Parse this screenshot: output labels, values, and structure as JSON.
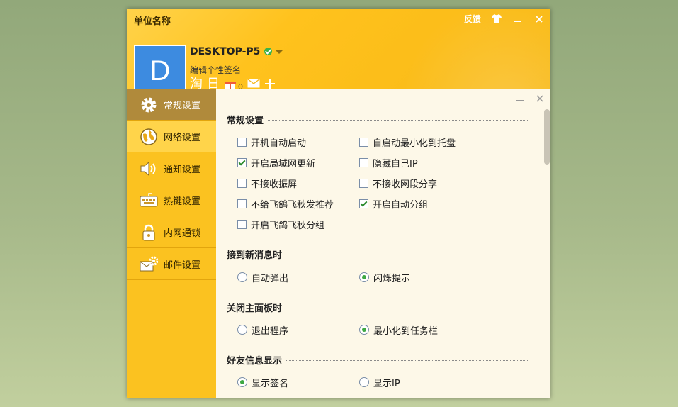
{
  "window": {
    "title": "单位名称",
    "feedback": "反馈",
    "colors": {
      "header": "#ffc21d",
      "sidebar": "#fbc220",
      "active_nav": "#b08a3b",
      "panel": "#fdf8e8",
      "avatar": "#3d8be0"
    }
  },
  "profile": {
    "avatar_letter": "D",
    "username": "DESKTOP-P5",
    "signature": "编辑个性签名",
    "mini_count": "0",
    "mini_icons": [
      "淘",
      "日"
    ]
  },
  "nav": [
    {
      "label": "常规设置",
      "icon": "gear-icon"
    },
    {
      "label": "网络设置",
      "icon": "globe-icon"
    },
    {
      "label": "通知设置",
      "icon": "speaker-icon"
    },
    {
      "label": "热键设置",
      "icon": "keyboard-icon"
    },
    {
      "label": "内网通锁",
      "icon": "lock-icon"
    },
    {
      "label": "邮件设置",
      "icon": "mail-gear-icon"
    }
  ],
  "sections": {
    "general": {
      "title": "常规设置",
      "options": [
        {
          "label": "开机自动启动",
          "checked": false
        },
        {
          "label": "自启动最小化到托盘",
          "checked": false
        },
        {
          "label": "开启局域网更新",
          "checked": true
        },
        {
          "label": "隐藏自己IP",
          "checked": false
        },
        {
          "label": "不接收振屏",
          "checked": false
        },
        {
          "label": "不接收网段分享",
          "checked": false
        },
        {
          "label": "不给飞鸽飞秋发推荐",
          "checked": false
        },
        {
          "label": "开启自动分组",
          "checked": true
        },
        {
          "label": "开启飞鸽飞秋分组",
          "checked": false
        }
      ]
    },
    "new_message": {
      "title": "接到新消息时",
      "options": [
        {
          "label": "自动弹出",
          "selected": false
        },
        {
          "label": "闪烁提示",
          "selected": true
        }
      ]
    },
    "close_panel": {
      "title": "关闭主面板时",
      "options": [
        {
          "label": "退出程序",
          "selected": false
        },
        {
          "label": "最小化到任务栏",
          "selected": true
        }
      ]
    },
    "friend_info": {
      "title": "好友信息显示",
      "options": [
        {
          "label": "显示签名",
          "selected": true
        },
        {
          "label": "显示IP",
          "selected": false
        }
      ]
    }
  }
}
